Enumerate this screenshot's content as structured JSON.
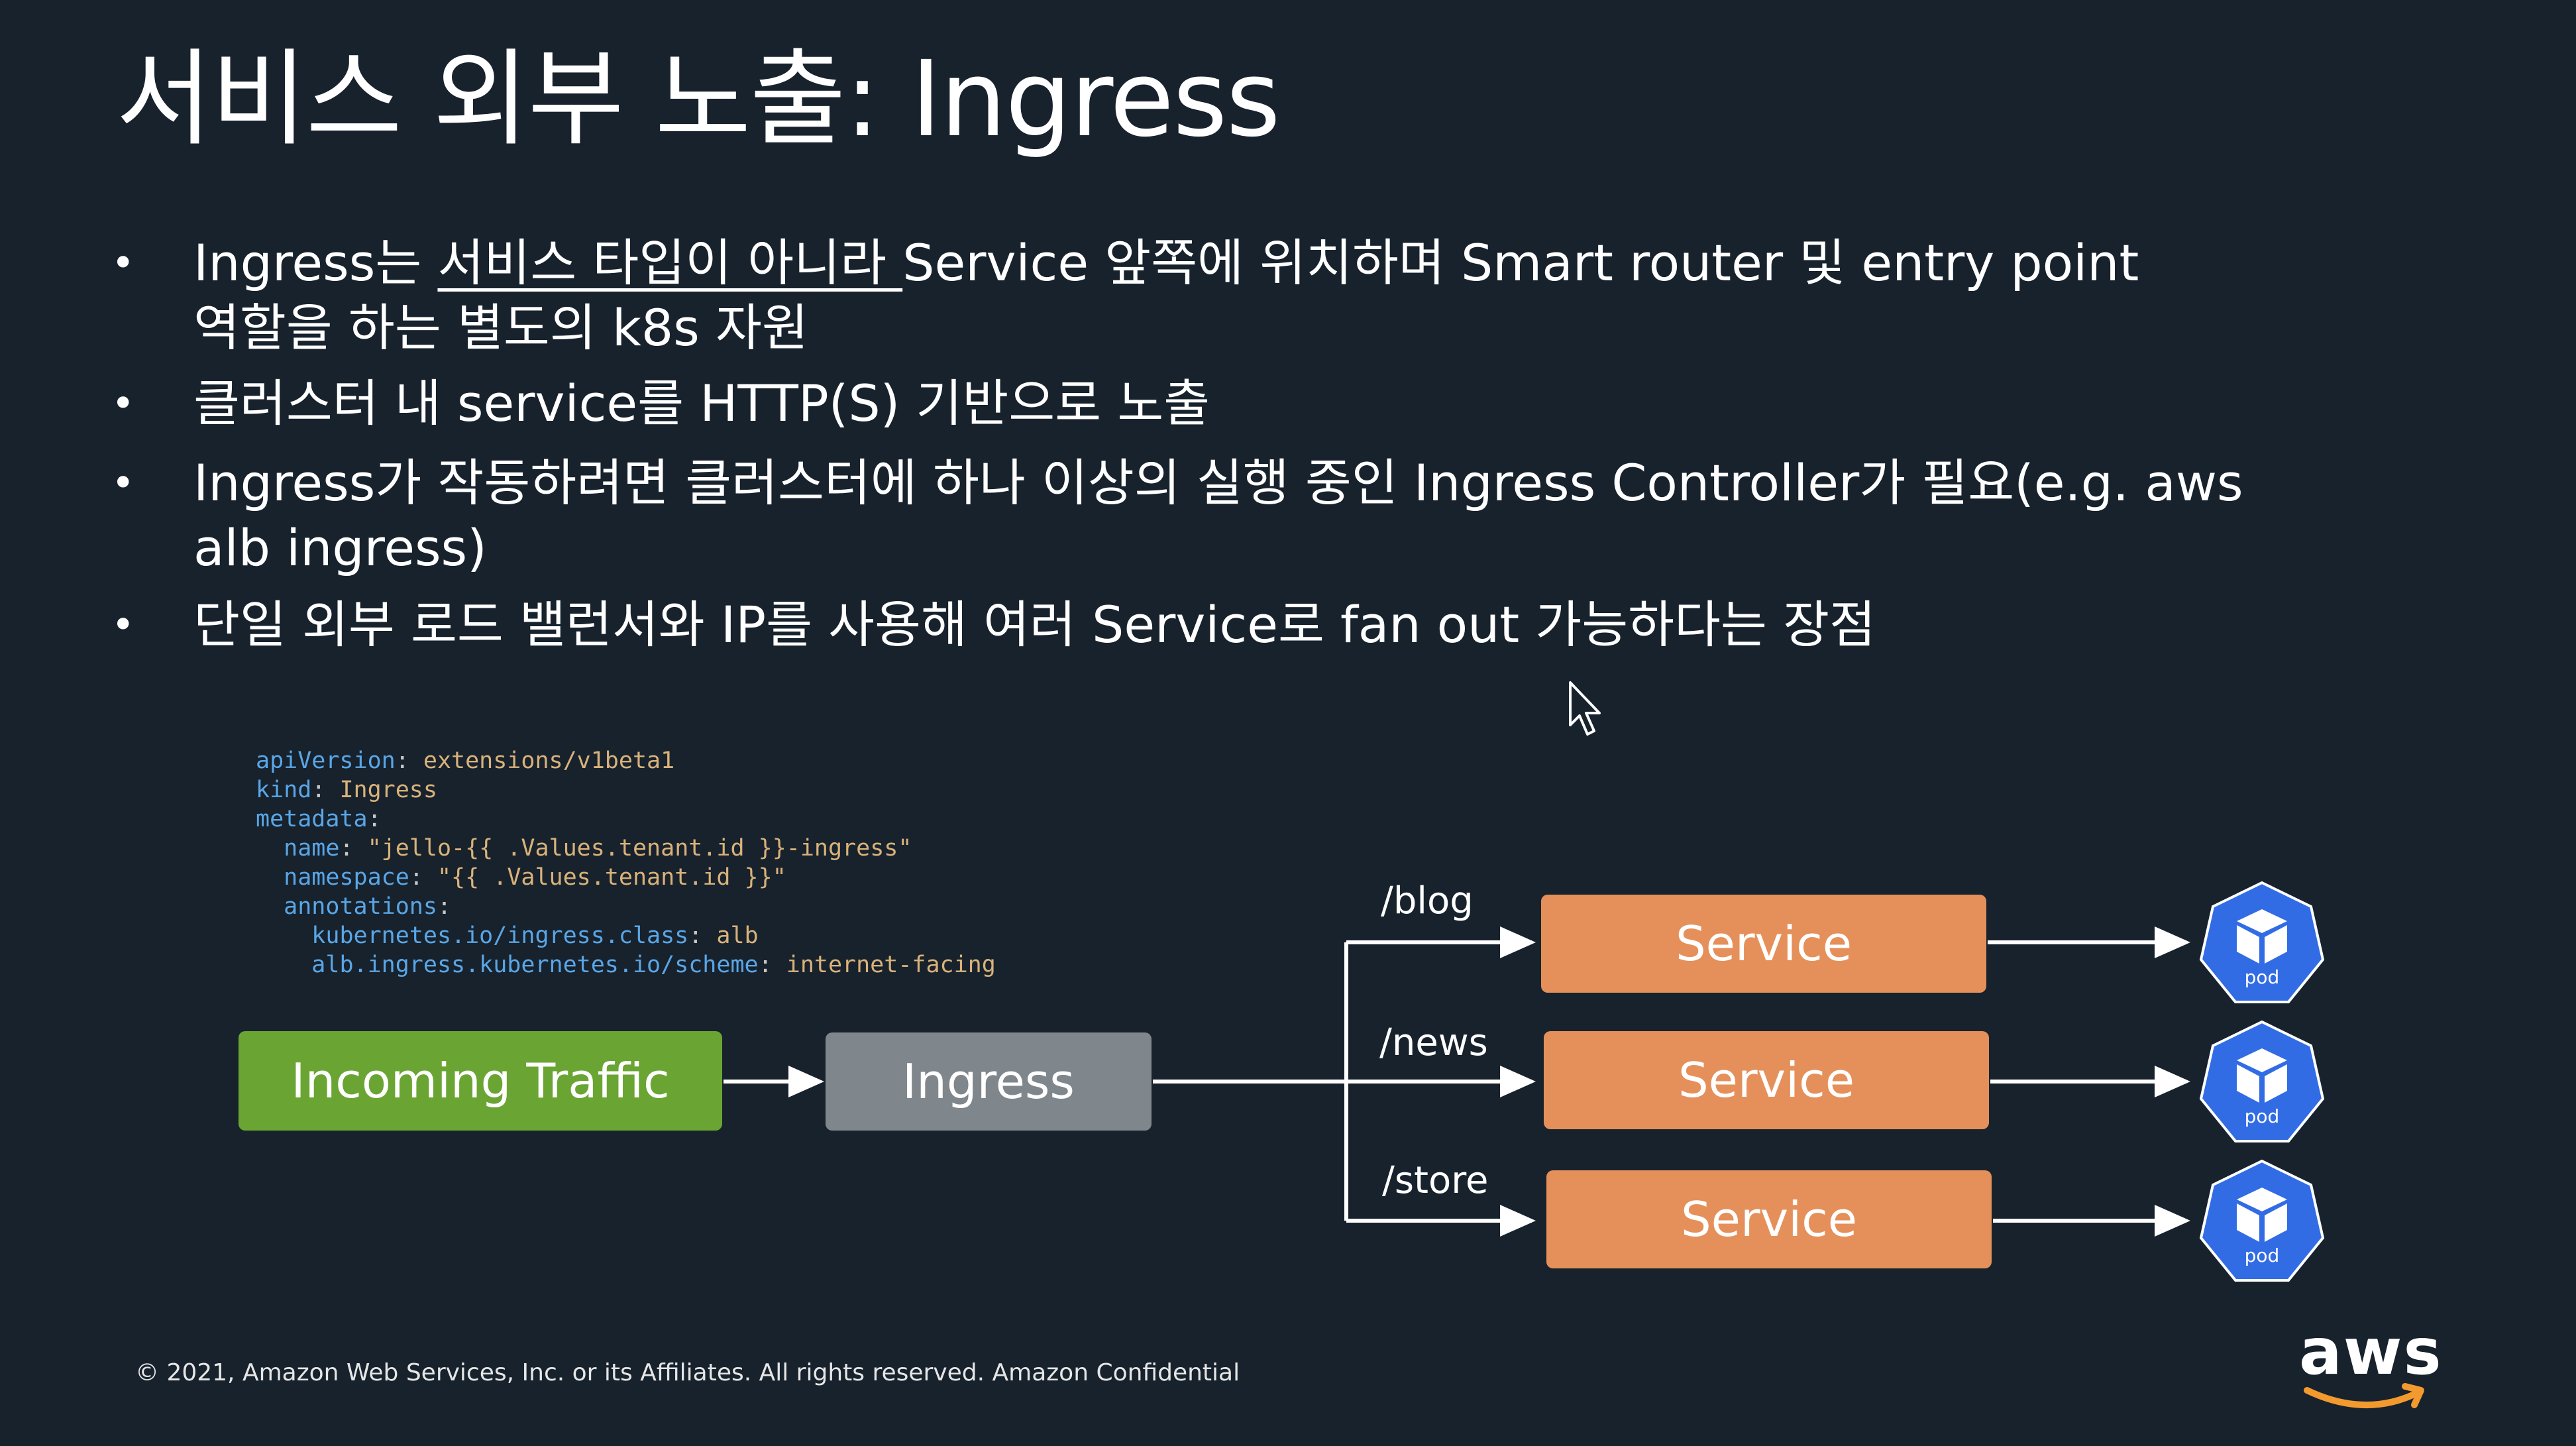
{
  "title": "서비스 외부 노출: Ingress",
  "bullets": [
    {
      "line1_before": "Ingress는 ",
      "line1_underline": "서비스 타입이 아니라 ",
      "line1_after": "Service 앞쪽에 위치하며 Smart router 및 entry point",
      "line2": "역할을 하는 별도의 k8s 자원"
    },
    {
      "line1": "클러스터 내 service를 HTTP(S) 기반으로 노출"
    },
    {
      "line1": "Ingress가 작동하려면 클러스터에 하나 이상의 실행 중인 Ingress Controller가 필요(e.g. aws",
      "line2": "alb ingress)"
    },
    {
      "line1": "단일 외부 로드 밸런서와 IP를 사용해 여러 Service로 fan out 가능하다는 장점"
    }
  ],
  "bullet_symbol": "•",
  "yaml": [
    {
      "key": "apiVersion",
      "value": "extensions/v1beta1"
    },
    {
      "key": "kind",
      "value": "Ingress"
    },
    {
      "key": "metadata",
      "value": ""
    },
    {
      "key": "name",
      "value": "\"jello-{{ .Values.tenant.id }}-ingress\""
    },
    {
      "key": "namespace",
      "value": "\"{{ .Values.tenant.id }}\""
    },
    {
      "key": "annotations",
      "value": ""
    },
    {
      "key": "kubernetes.io/ingress.class",
      "value": "alb"
    },
    {
      "key": "alb.ingress.kubernetes.io/scheme",
      "value": "internet-facing"
    }
  ],
  "diagram": {
    "incoming": "Incoming Traffic",
    "ingress": "Ingress",
    "routes": [
      {
        "path": "/blog",
        "service": "Service",
        "pod": "pod"
      },
      {
        "path": "/news",
        "service": "Service",
        "pod": "pod"
      },
      {
        "path": "/store",
        "service": "Service",
        "pod": "pod"
      }
    ]
  },
  "footer": "© 2021, Amazon Web Services, Inc. or its Affiliates. All rights reserved. Amazon Confidential",
  "logo_text": "aws",
  "colors": {
    "background": "#17222d",
    "incoming": "#6aa534",
    "ingress": "#7f878d",
    "service": "#e5905a",
    "pod": "#326ce5",
    "aws_smile": "#f29a2e"
  },
  "icons": {
    "pod": "kubernetes-pod-cube-icon",
    "cursor": "mouse-pointer-icon",
    "logo": "aws-logo-icon"
  }
}
